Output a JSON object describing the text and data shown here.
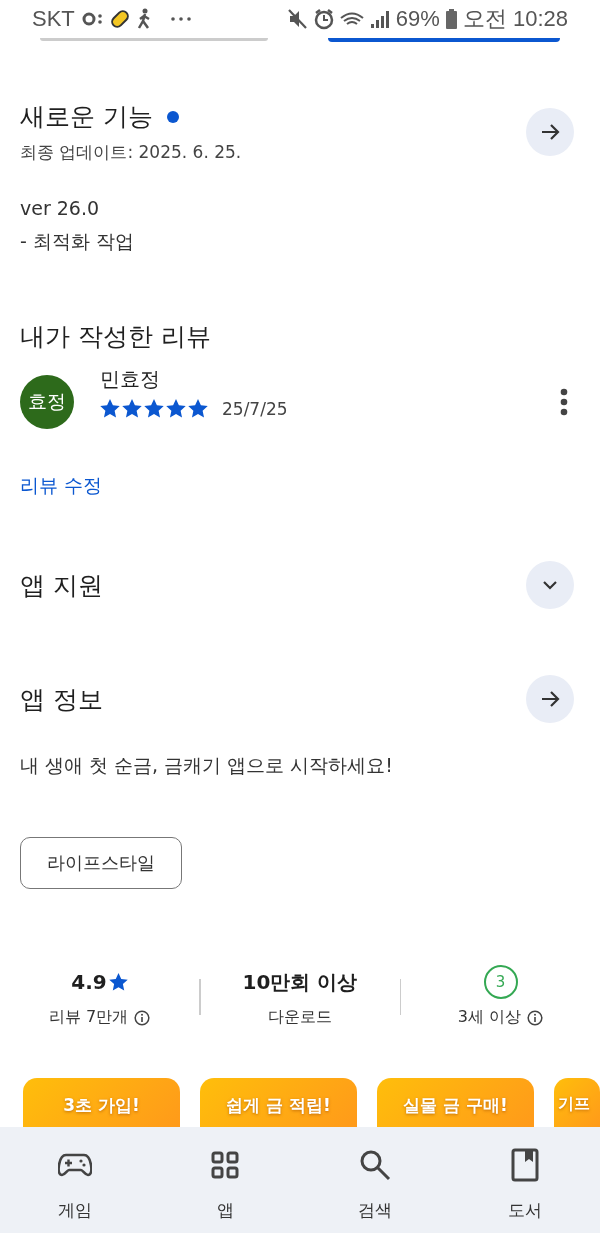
{
  "status_bar": {
    "carrier": "SKT",
    "battery": "69%",
    "time": "오전 10:28"
  },
  "whats_new": {
    "title": "새로운 기능",
    "unread": true,
    "updated": "최종 업데이트: 2025. 6. 25.",
    "lines": [
      "ver 26.0",
      "- 최적화 작업"
    ]
  },
  "my_review": {
    "title": "내가 작성한 리뷰",
    "avatar": "효정",
    "name": "민효정",
    "stars": 5,
    "date": "25/7/25",
    "edit_link": "리뷰 수정"
  },
  "app_support": {
    "title": "앱 지원",
    "expanded": false
  },
  "app_info": {
    "title": "앱 정보",
    "description": "내 생애 첫 순금, 금캐기 앱으로 시작하세요!",
    "category": "라이프스타일"
  },
  "stats": [
    {
      "kind": "rating",
      "value": "4.9",
      "label": "리뷰 7만개"
    },
    {
      "kind": "downloads",
      "value": "10만회 이상",
      "label": "다운로드"
    },
    {
      "kind": "age",
      "value": "3",
      "label": "3세 이상"
    }
  ],
  "screenshots": [
    {
      "headline": "3초 가입!"
    },
    {
      "headline": "쉽게 금 적립!"
    },
    {
      "headline": "실물 금 구매!"
    },
    {
      "headline": "기프"
    }
  ],
  "bottom_nav": [
    {
      "label": "게임",
      "selected": false
    },
    {
      "label": "앱",
      "selected": false
    },
    {
      "label": "검색",
      "selected": false
    },
    {
      "label": "도서",
      "selected": false
    }
  ]
}
